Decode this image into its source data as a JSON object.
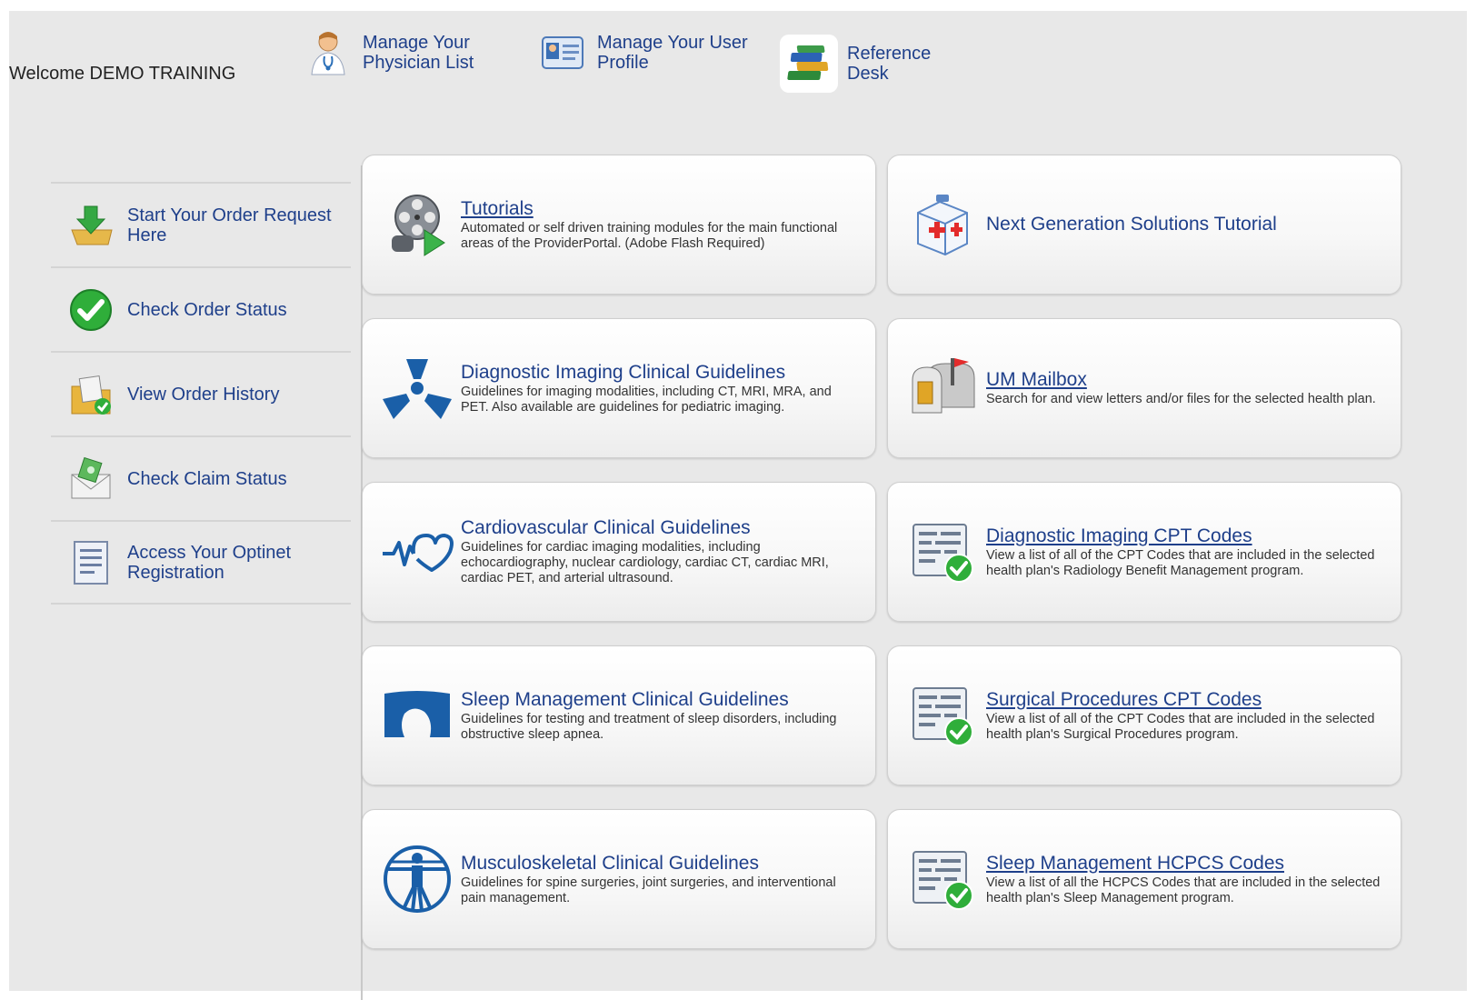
{
  "header": {
    "welcome": "Welcome DEMO TRAINING",
    "links": [
      {
        "label": "Manage Your Physician List",
        "icon": "physician-icon"
      },
      {
        "label": "Manage Your User Profile",
        "icon": "profile-card-icon"
      },
      {
        "label": "Reference Desk",
        "icon": "books-icon"
      }
    ]
  },
  "sidebar": {
    "items": [
      {
        "label": "Start Your Order Request Here",
        "icon": "order-download-icon"
      },
      {
        "label": "Check Order Status",
        "icon": "green-check-icon"
      },
      {
        "label": "View Order History",
        "icon": "folder-history-icon"
      },
      {
        "label": "Check Claim Status",
        "icon": "claim-envelope-icon"
      },
      {
        "label": "Access Your Optinet Registration",
        "icon": "document-list-icon"
      }
    ]
  },
  "cards": [
    {
      "title": "Tutorials",
      "desc": "Automated or self driven training modules for the main functional areas of the ProviderPortal. (Adobe Flash Required)",
      "icon": "film-reel-icon"
    },
    {
      "title": "Next Generation Solutions Tutorial",
      "desc": "",
      "icon": "first-aid-box-icon"
    },
    {
      "title": "Diagnostic Imaging Clinical Guidelines",
      "desc": "Guidelines for imaging modalities, including CT, MRI, MRA, and PET. Also available are guidelines for pediatric imaging.",
      "icon": "radiation-icon"
    },
    {
      "title": "UM Mailbox",
      "desc": "Search for and view letters and/or files for the selected health plan.",
      "icon": "mailbox-icon"
    },
    {
      "title": "Cardiovascular Clinical Guidelines",
      "desc": "Guidelines for cardiac imaging modalities, including echocardiography, nuclear cardiology, cardiac CT, cardiac MRI, cardiac PET, and arterial ultrasound.",
      "icon": "heartbeat-icon"
    },
    {
      "title": "Diagnostic Imaging CPT Codes",
      "desc": "View a list of all of the CPT Codes that are included in the selected health plan's Radiology Benefit Management program.",
      "icon": "code-list-check-icon"
    },
    {
      "title": "Sleep Management Clinical Guidelines",
      "desc": "Guidelines for testing and treatment of sleep disorders, including obstructive sleep apnea.",
      "icon": "sleep-head-icon"
    },
    {
      "title": "Surgical Procedures CPT Codes",
      "desc": "View a list of all of the CPT Codes that are included in the selected health plan's Surgical Procedures program.",
      "icon": "code-list-check-icon"
    },
    {
      "title": "Musculoskeletal Clinical Guidelines",
      "desc": "Guidelines for spine surgeries, joint surgeries, and interventional pain management.",
      "icon": "vitruvian-man-icon"
    },
    {
      "title": "Sleep Management HCPCS Codes",
      "desc": "View a list of all the HCPCS Codes that are included in the selected health plan's Sleep Management program.",
      "icon": "code-list-check-icon"
    }
  ],
  "colors": {
    "link": "#1e3f8a",
    "background": "#e8e8e8",
    "accent_blue": "#1a5fa8",
    "check_green": "#2fae3a"
  }
}
